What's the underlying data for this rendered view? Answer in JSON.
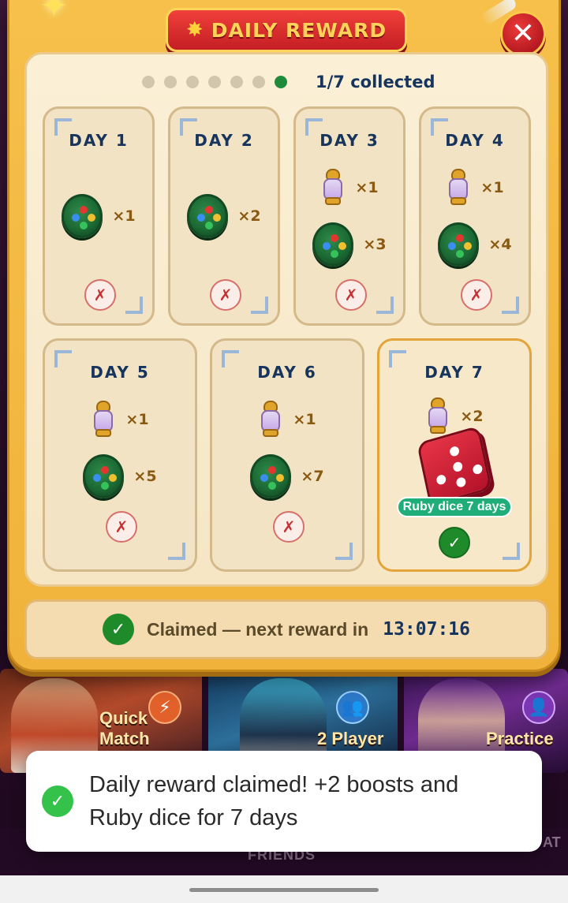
{
  "modal": {
    "title": "DAILY REWARD",
    "close_label": "✕",
    "progress": {
      "collected": 1,
      "total": 7,
      "label": "1/7 collected"
    }
  },
  "days": [
    {
      "label": "DAY 1",
      "status": "missed",
      "rewards": [
        {
          "icon": "green-coin-icon",
          "qty": "×1"
        }
      ]
    },
    {
      "label": "DAY 2",
      "status": "missed",
      "rewards": [
        {
          "icon": "green-coin-icon",
          "qty": "×2"
        }
      ]
    },
    {
      "label": "DAY 3",
      "status": "missed",
      "rewards": [
        {
          "icon": "potion-icon",
          "qty": "×1"
        },
        {
          "icon": "green-coin-icon",
          "qty": "×3"
        }
      ]
    },
    {
      "label": "DAY 4",
      "status": "missed",
      "rewards": [
        {
          "icon": "potion-icon",
          "qty": "×1"
        },
        {
          "icon": "green-coin-icon",
          "qty": "×4"
        }
      ]
    },
    {
      "label": "DAY 5",
      "status": "missed",
      "rewards": [
        {
          "icon": "potion-icon",
          "qty": "×1"
        },
        {
          "icon": "green-coin-icon",
          "qty": "×5"
        }
      ]
    },
    {
      "label": "DAY 6",
      "status": "missed",
      "rewards": [
        {
          "icon": "potion-icon",
          "qty": "×1"
        },
        {
          "icon": "green-coin-icon",
          "qty": "×7"
        }
      ]
    },
    {
      "label": "DAY 7",
      "status": "claimed",
      "rewards": [
        {
          "icon": "potion-icon",
          "qty": "×2"
        },
        {
          "icon": "ruby-dice-icon",
          "badge": "Ruby dice 7 days"
        }
      ]
    }
  ],
  "status_marks": {
    "missed": "✗",
    "claimed": "✓"
  },
  "claim_bar": {
    "text": "Claimed — next reward in",
    "timer": "13:07:16",
    "check": "✓"
  },
  "toast": {
    "message": "Daily reward claimed! +2 boosts and Ruby dice for 7 days",
    "icon": "check-circle-icon",
    "check": "✓"
  },
  "background": {
    "modes": [
      "Quick Match",
      "2 Player",
      "Practice"
    ],
    "nav": {
      "friends": "FRIENDS",
      "chat": "AT"
    }
  },
  "colors": {
    "modal_gold": "#f6c04a",
    "title_red": "#c41e24",
    "navy_text": "#17345c",
    "claimed_green": "#1f8a2a",
    "missed_red": "#c53030",
    "badge_teal": "#1fae7a"
  }
}
